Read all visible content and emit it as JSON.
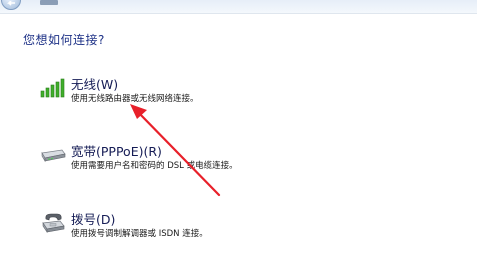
{
  "prompt": "您想如何连接?",
  "options": [
    {
      "label": "无线(W)",
      "description": "使用无线路由器或无线网络连接。",
      "icon": "wireless-signal-icon"
    },
    {
      "label": "宽带(PPPoE)(R)",
      "description": "使用需要用户名和密码的 DSL 或电缆连接。",
      "icon": "modem-icon"
    },
    {
      "label": "拨号(D)",
      "description": "使用拨号调制解调器或 ISDN 连接。",
      "icon": "phone-modem-icon"
    }
  ],
  "colors": {
    "prompt_text": "#1e3287",
    "option_title": "#151c55",
    "annotation_arrow": "#e8202a",
    "signal_green": "#3fae2a"
  }
}
